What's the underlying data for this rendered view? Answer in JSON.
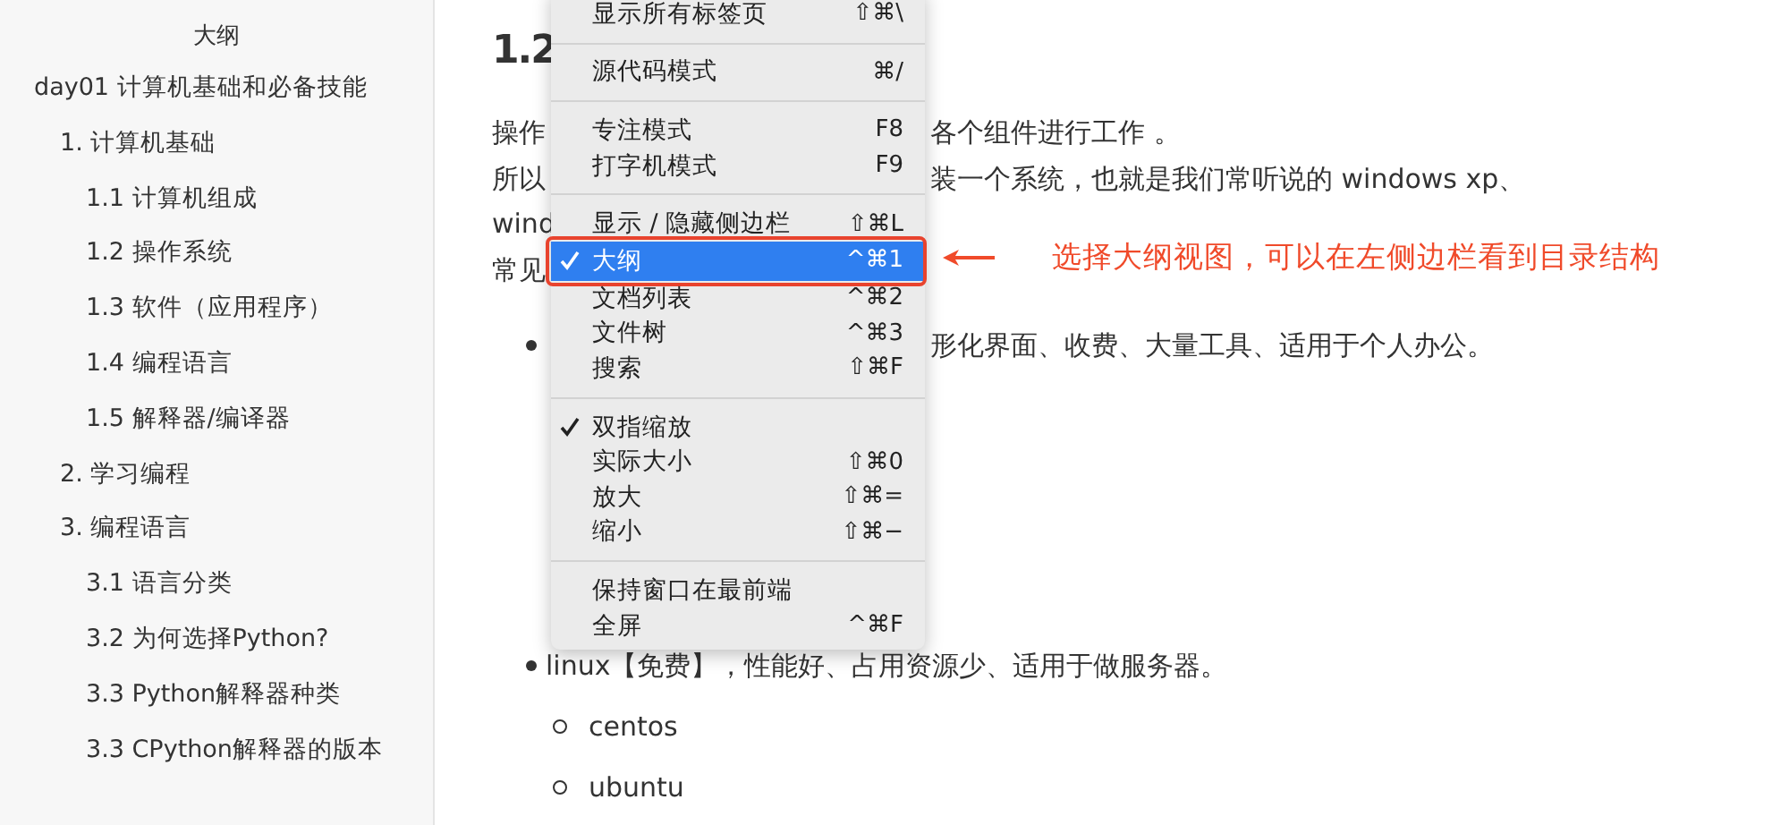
{
  "sidebar": {
    "title": "大纲",
    "items": [
      {
        "label": "day01 计算机基础和必备技能",
        "children": [
          {
            "label": "1. 计算机基础",
            "children": [
              {
                "label": "1.1 计算机组成"
              },
              {
                "label": "1.2 操作系统"
              },
              {
                "label": "1.3 软件（应用程序）"
              },
              {
                "label": "1.4 编程语言"
              },
              {
                "label": "1.5 解释器/编译器"
              }
            ]
          },
          {
            "label": "2. 学习编程"
          },
          {
            "label": "3. 编程语言",
            "children": [
              {
                "label": "3.1 语言分类"
              },
              {
                "label": "3.2 为何选择Python?"
              },
              {
                "label": "3.3 Python解释器种类"
              },
              {
                "label": "3.3 CPython解释器的版本"
              }
            ]
          }
        ]
      }
    ]
  },
  "document": {
    "heading": "1.2",
    "paragraph_lines": [
      {
        "left": "操作",
        "right": "各个组件进行工作 。"
      },
      {
        "left": "所以",
        "right": "装一个系统，也就是我们常听说的 windows xp、"
      },
      {
        "left": "wind"
      },
      {
        "left": "常见"
      }
    ],
    "bullets": [
      {
        "right": "形化界面、收费、大量工具、适用于个人办公。"
      },
      {
        "left": "linux【免费】，性能好、占用资源少、适用于做服务器。",
        "children": [
          "centos",
          "ubuntu"
        ]
      }
    ]
  },
  "menu": {
    "groups": [
      [
        {
          "label": "显示所有标签页",
          "shortcut": "⇧⌘\\",
          "checked": false,
          "selected": false
        }
      ],
      [
        {
          "label": "源代码模式",
          "shortcut": "⌘/",
          "checked": false,
          "selected": false
        }
      ],
      [
        {
          "label": "专注模式",
          "shortcut": "F8",
          "checked": false,
          "selected": false
        },
        {
          "label": "打字机模式",
          "shortcut": "F9",
          "checked": false,
          "selected": false
        }
      ],
      [
        {
          "label": "显示 / 隐藏侧边栏",
          "shortcut": "⇧⌘L",
          "checked": false,
          "selected": false
        },
        {
          "label": "大纲",
          "shortcut": "^⌘1",
          "checked": true,
          "selected": true
        },
        {
          "label": "文档列表",
          "shortcut": "^⌘2",
          "checked": false,
          "selected": false
        },
        {
          "label": "文件树",
          "shortcut": "^⌘3",
          "checked": false,
          "selected": false
        },
        {
          "label": "搜索",
          "shortcut": "⇧⌘F",
          "checked": false,
          "selected": false
        }
      ],
      [
        {
          "label": "双指缩放",
          "checked": true,
          "selected": false
        },
        {
          "label": "实际大小",
          "shortcut": "⇧⌘0",
          "checked": false,
          "selected": false
        },
        {
          "label": "放大",
          "shortcut": "⇧⌘=",
          "checked": false,
          "selected": false
        },
        {
          "label": "缩小",
          "shortcut": "⇧⌘−",
          "checked": false,
          "selected": false
        }
      ],
      [
        {
          "label": "保持窗口在最前端",
          "checked": false,
          "selected": false
        },
        {
          "label": "全屏",
          "shortcut": "^⌘F",
          "checked": false,
          "selected": false
        }
      ]
    ]
  },
  "annotation": {
    "text": "选择大纲视图，可以在左侧边栏看到目录结构"
  }
}
